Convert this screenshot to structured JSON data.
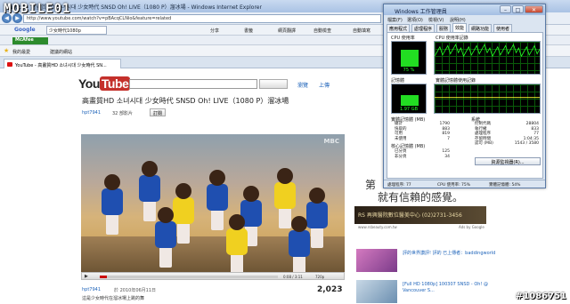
{
  "browser": {
    "title": "YouTube - 高畫質HD 소녀시대 少女時代 SNSD Oh! LIVE（1080 P）溜冰場 - Windows Internet Explorer",
    "address": "http://www.youtube.com/watch?v=pBAcqCLNio&feature=related",
    "toolbar": {
      "google": "Google",
      "search_value": "少女時代1080p",
      "share": "分享",
      "bookmarks": "書籤",
      "pagerank": "網頁翻譯",
      "autocheck": "自動檢查",
      "autofill": "自動填寫"
    },
    "mcafee": "McAfee",
    "favorites": {
      "label": "我的最愛",
      "suggested": "建議的網站"
    },
    "tab_label": "YouTube - 高畫質HD 소녀시대 少女時代 SN..."
  },
  "youtube": {
    "logo_you": "You",
    "logo_tube": "Tube",
    "links": [
      "瀏覽",
      "上傳"
    ],
    "video_title": "高畫質HD 소녀시대 少女時代 SNSD Oh! LIVE（1080 P）溜冰場",
    "channel": "hpt7941",
    "channel_meta": "32 部影片",
    "subscribe": "訂閱",
    "video_watermark": "MBC",
    "time": "0:08 / 3:11",
    "quality": "720p",
    "progress_fraction": 0.04,
    "uploader": "hpt7941",
    "upload_date": "於 2010年06月11日",
    "description": "這是少女時代在溜冰場上跳的舞",
    "views": "2,023"
  },
  "sidebar": {
    "ad_text_line1": "第",
    "ad_text_line2": "就有信賴的感覺。",
    "ad_banner": "RS 再興醫院數位醫美中心  (02)2731-3456",
    "ad_footer": "www.rsbeauty.com.tw",
    "ad_by": "Ads by Google",
    "recs": [
      "評的世界讚評! 評的 已上傳者：baddingworld",
      "[Full HD 1080p] 100307 SNSD - Oh! @ Vancouver S..."
    ]
  },
  "taskmgr": {
    "title": "Windows 工作管理員",
    "menu": [
      "檔案(F)",
      "選項(O)",
      "檢視(V)",
      "說明(H)"
    ],
    "tabs": [
      "應用程式",
      "處理程序",
      "服務",
      "效能",
      "網路功能",
      "使用者"
    ],
    "cpu_label": "CPU 使用率",
    "cpu_history_label": "CPU 使用率記錄",
    "cpu_value": "75 %",
    "mem_label": "記憶體",
    "mem_history_label": "實體記憶體使用記錄",
    "mem_value": "1.97 GB",
    "phys_label": "實體記憶體 (MB)",
    "phys": [
      {
        "k": "總計",
        "v": "1790"
      },
      {
        "k": "快取的",
        "v": "883"
      },
      {
        "k": "可用",
        "v": "819"
      },
      {
        "k": "未使用",
        "v": "7"
      }
    ],
    "system_label": "系統",
    "system": [
      {
        "k": "控制代碼",
        "v": "28804"
      },
      {
        "k": "執行緒",
        "v": "833"
      },
      {
        "k": "處理程序",
        "v": "77"
      },
      {
        "k": "存留時間",
        "v": "1:04:35"
      },
      {
        "k": "認可 (MB)",
        "v": "1543 / 3580"
      }
    ],
    "kernel_label": "核心記憶體 (MB)",
    "kernel": [
      {
        "k": "已分頁",
        "v": "125"
      },
      {
        "k": "非分頁",
        "v": "34"
      }
    ],
    "resmon_button": "資源監視器(R)...",
    "status": {
      "processes": "處理程序: 77",
      "cpu": "CPU 使用率: 75%",
      "memory": "實體記憶體: 54%"
    },
    "cpu_fraction": 0.75,
    "mem_fraction": 0.54
  },
  "watermarks": {
    "left": "MOBILE01",
    "right": "#1086751"
  }
}
